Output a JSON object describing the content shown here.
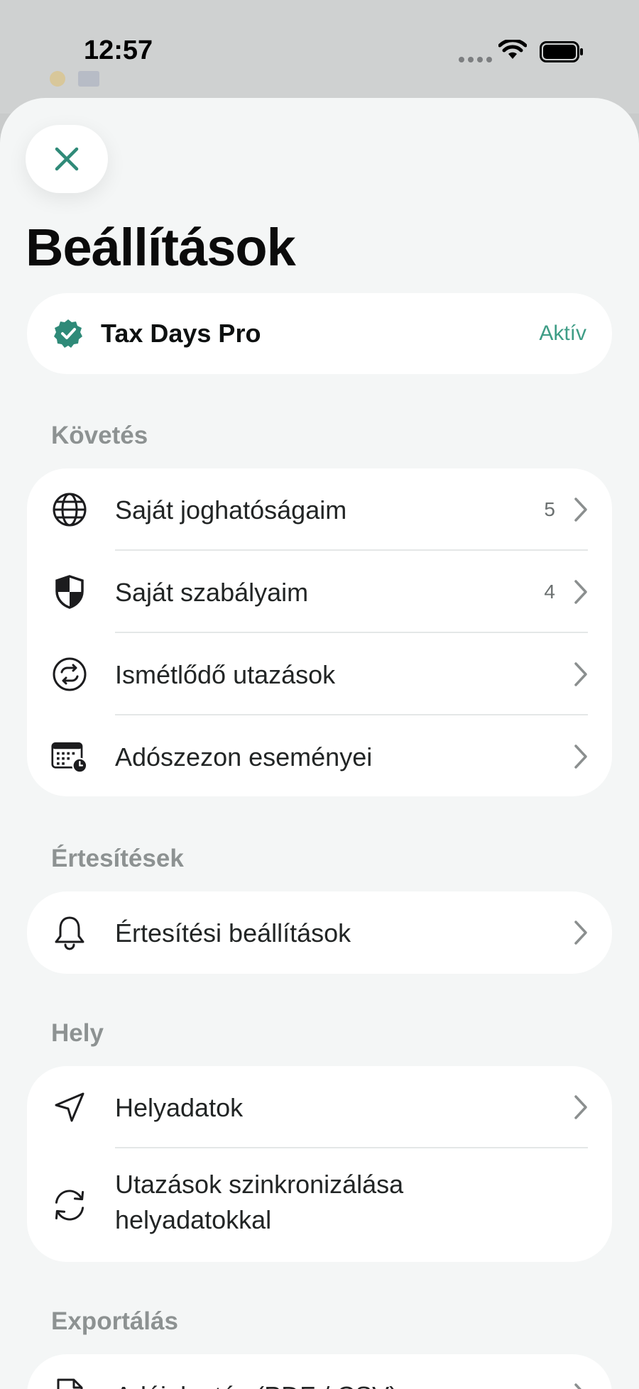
{
  "status_bar": {
    "time": "12:57"
  },
  "title": "Beállítások",
  "subscription": {
    "name": "Tax Days Pro",
    "status": "Aktív"
  },
  "sections": {
    "tracking": {
      "title": "Követés",
      "items": [
        {
          "label": "Saját joghatóságaim",
          "count": "5",
          "icon": "globe-icon"
        },
        {
          "label": "Saját szabályaim",
          "count": "4",
          "icon": "shield-icon"
        },
        {
          "label": "Ismétlődő utazások",
          "icon": "repeat-icon"
        },
        {
          "label": "Adószezon eseményei",
          "icon": "calendar-clock-icon"
        }
      ]
    },
    "notifications": {
      "title": "Értesítések",
      "items": [
        {
          "label": "Értesítési beállítások",
          "icon": "bell-icon"
        }
      ]
    },
    "location": {
      "title": "Hely",
      "items": [
        {
          "label": "Helyadatok",
          "icon": "location-arrow-icon"
        },
        {
          "label_line1": "Utazások szinkronizálása",
          "label_line2": "helyadatokkal",
          "icon": "sync-icon"
        }
      ]
    },
    "export": {
      "title": "Exportálás",
      "items": [
        {
          "label": "Adójelentés (PDF / CSV)",
          "icon": "document-icon"
        }
      ]
    }
  },
  "colors": {
    "accent": "#2f8a78",
    "status_green": "#3f9d86",
    "sheet_bg": "#f4f6f6"
  }
}
